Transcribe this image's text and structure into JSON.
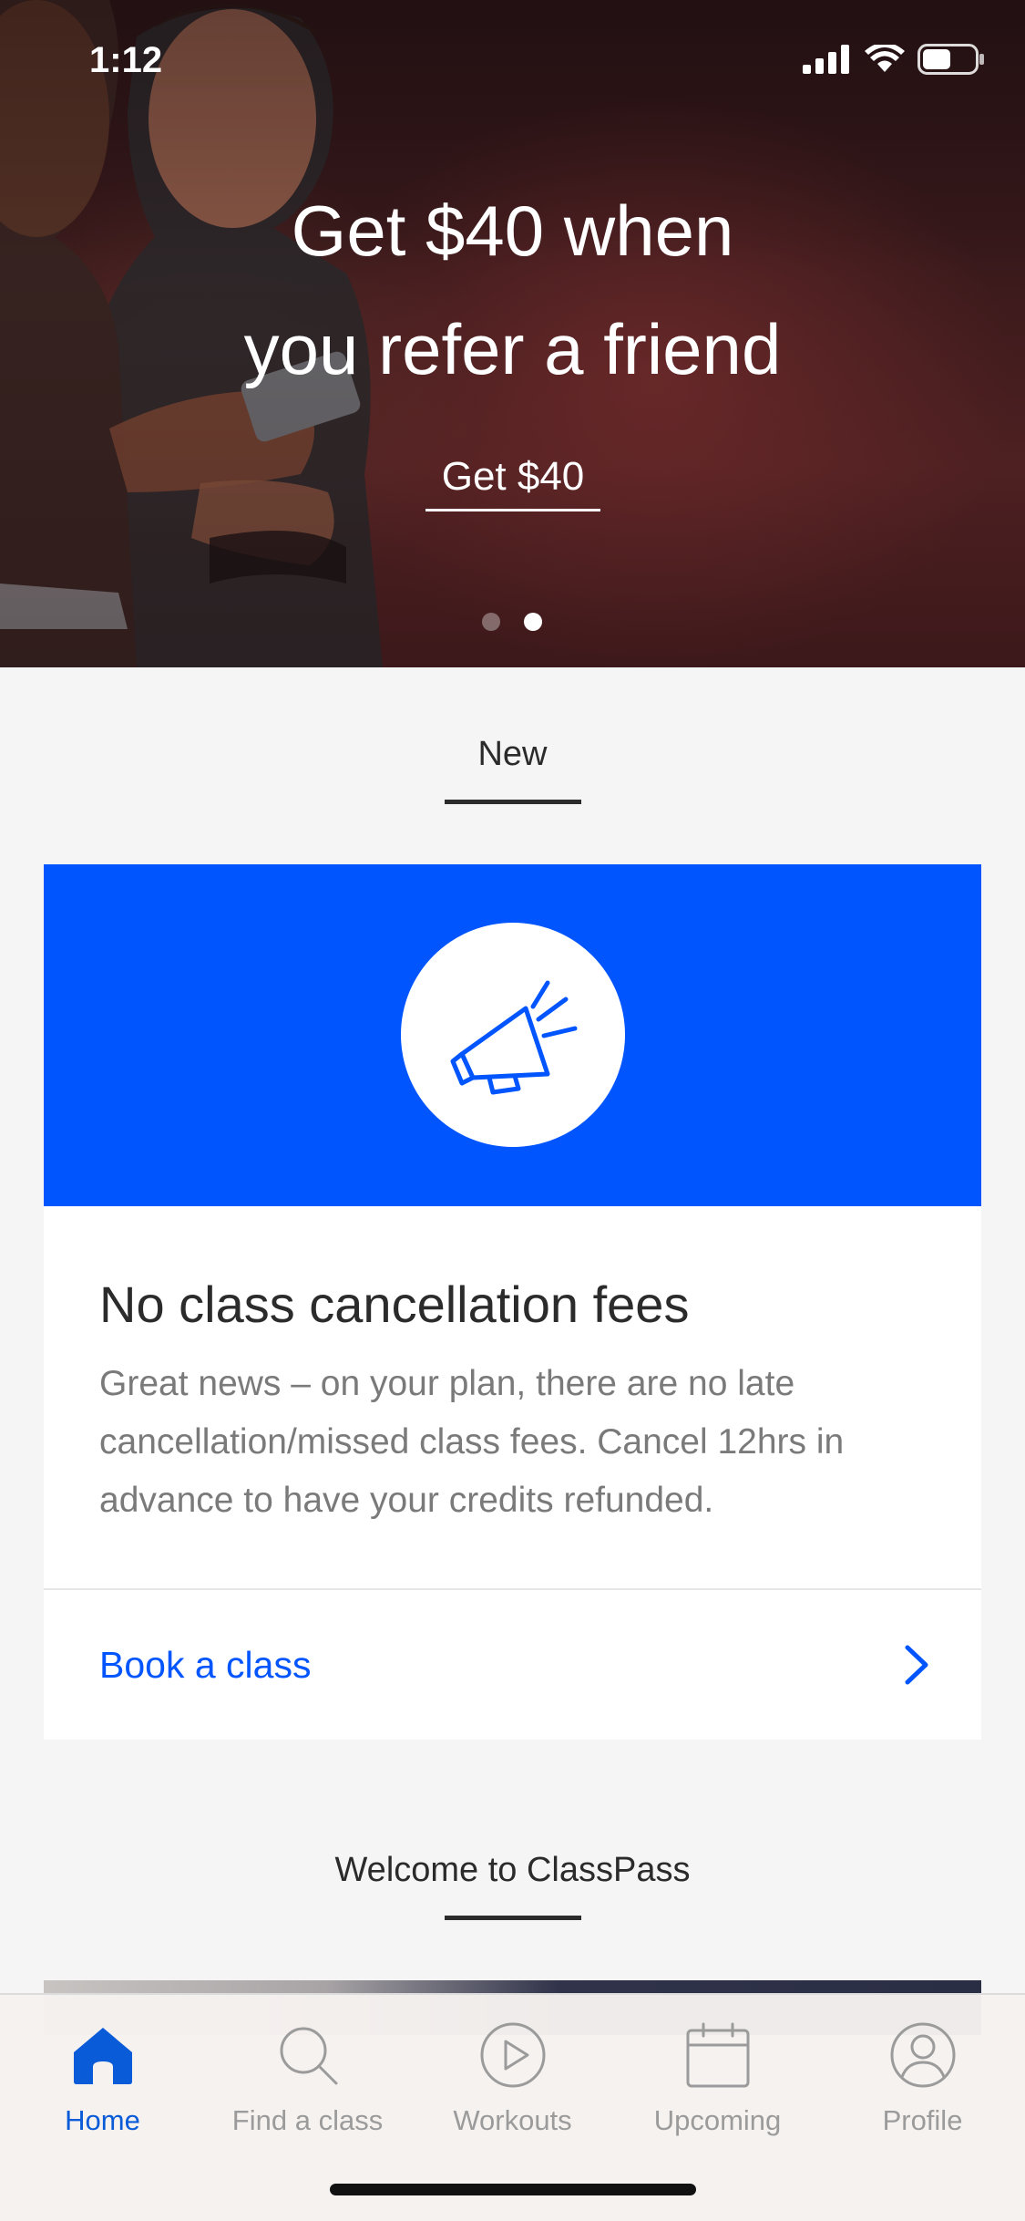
{
  "status_bar": {
    "time": "1:12",
    "icons": [
      "cellular-signal-icon",
      "wifi-icon",
      "battery-icon"
    ]
  },
  "hero": {
    "title_line1": "Get $40 when",
    "title_line2": "you refer a friend",
    "cta_label": "Get $40",
    "carousel_pages": 2,
    "carousel_active_index": 1
  },
  "new_section": {
    "heading": "New"
  },
  "card": {
    "banner_color": "#0055ff",
    "icon": "megaphone-icon",
    "title": "No class cancellation fees",
    "body": "Great news – on your plan, there are no late cancellation/missed class fees. Cancel 12hrs in advance to have your credits refunded.",
    "link_label": "Book a class",
    "link_icon": "chevron-right-icon"
  },
  "welcome_section": {
    "heading": "Welcome to ClassPass"
  },
  "tabbar": {
    "active_color": "#0a5bd8",
    "items": [
      {
        "label": "Home",
        "icon": "home-icon",
        "active": true
      },
      {
        "label": "Find a class",
        "icon": "search-icon",
        "active": false
      },
      {
        "label": "Workouts",
        "icon": "play-circle-icon",
        "active": false
      },
      {
        "label": "Upcoming",
        "icon": "calendar-icon",
        "active": false
      },
      {
        "label": "Profile",
        "icon": "profile-icon",
        "active": false
      }
    ]
  }
}
